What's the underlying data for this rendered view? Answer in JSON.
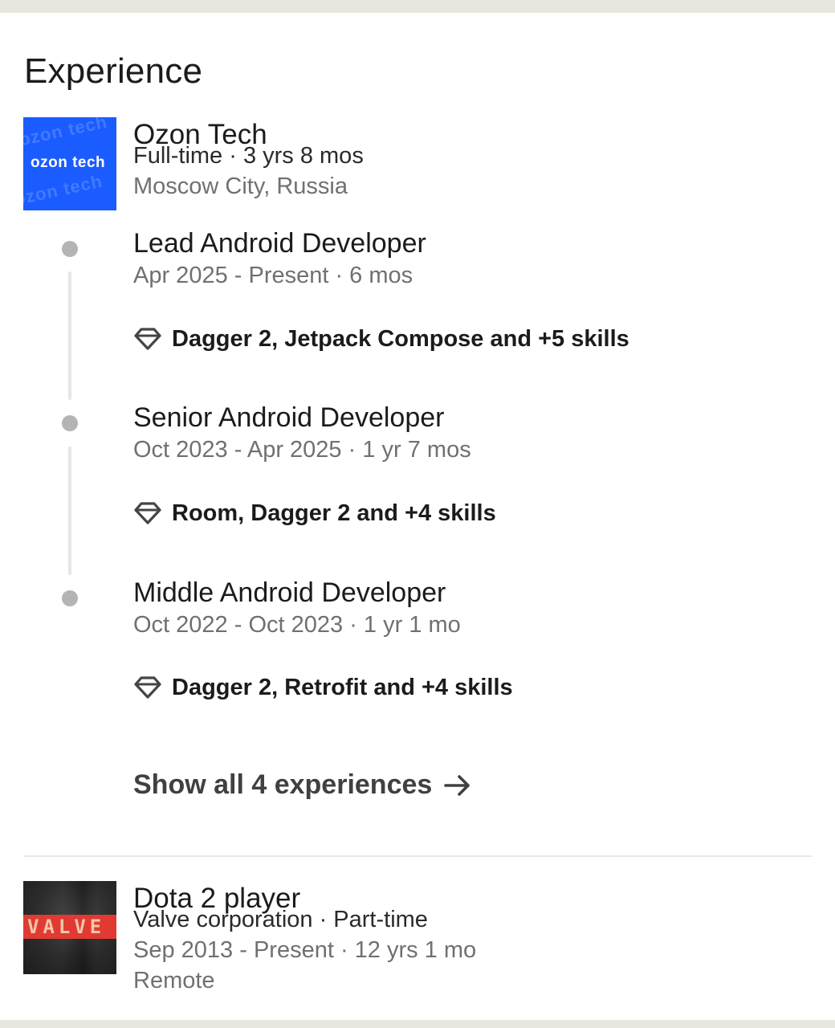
{
  "section": {
    "title": "Experience"
  },
  "ozon": {
    "logo_text": "ozon tech",
    "name": "Ozon Tech",
    "employment": "Full-time · 3 yrs 8 mos",
    "location": "Moscow City, Russia",
    "roles": [
      {
        "title": "Lead Android Developer",
        "dates": "Apr 2025 - Present · 6 mos",
        "skills": "Dagger 2, Jetpack Compose and +5 skills"
      },
      {
        "title": "Senior Android Developer",
        "dates": "Oct 2023 - Apr 2025 · 1 yr 7 mos",
        "skills": "Room, Dagger 2 and +4 skills"
      },
      {
        "title": "Middle Android Developer",
        "dates": "Oct 2022 - Oct 2023 · 1 yr 1 mo",
        "skills": "Dagger 2, Retrofit and +4 skills"
      }
    ],
    "show_all": "Show all 4 experiences"
  },
  "valve": {
    "logo_text": "VALVE",
    "title": "Dota 2 player",
    "company": "Valve corporation · Part-time",
    "dates": "Sep 2013 - Present · 12 yrs 1 mo",
    "location": "Remote"
  },
  "colors": {
    "ozon_brand": "#1a5cff",
    "valve_band": "#e03a33",
    "timeline": "#b4b4b4"
  },
  "icons": {
    "skills": "diamond-icon",
    "show_all": "arrow-right-icon"
  }
}
